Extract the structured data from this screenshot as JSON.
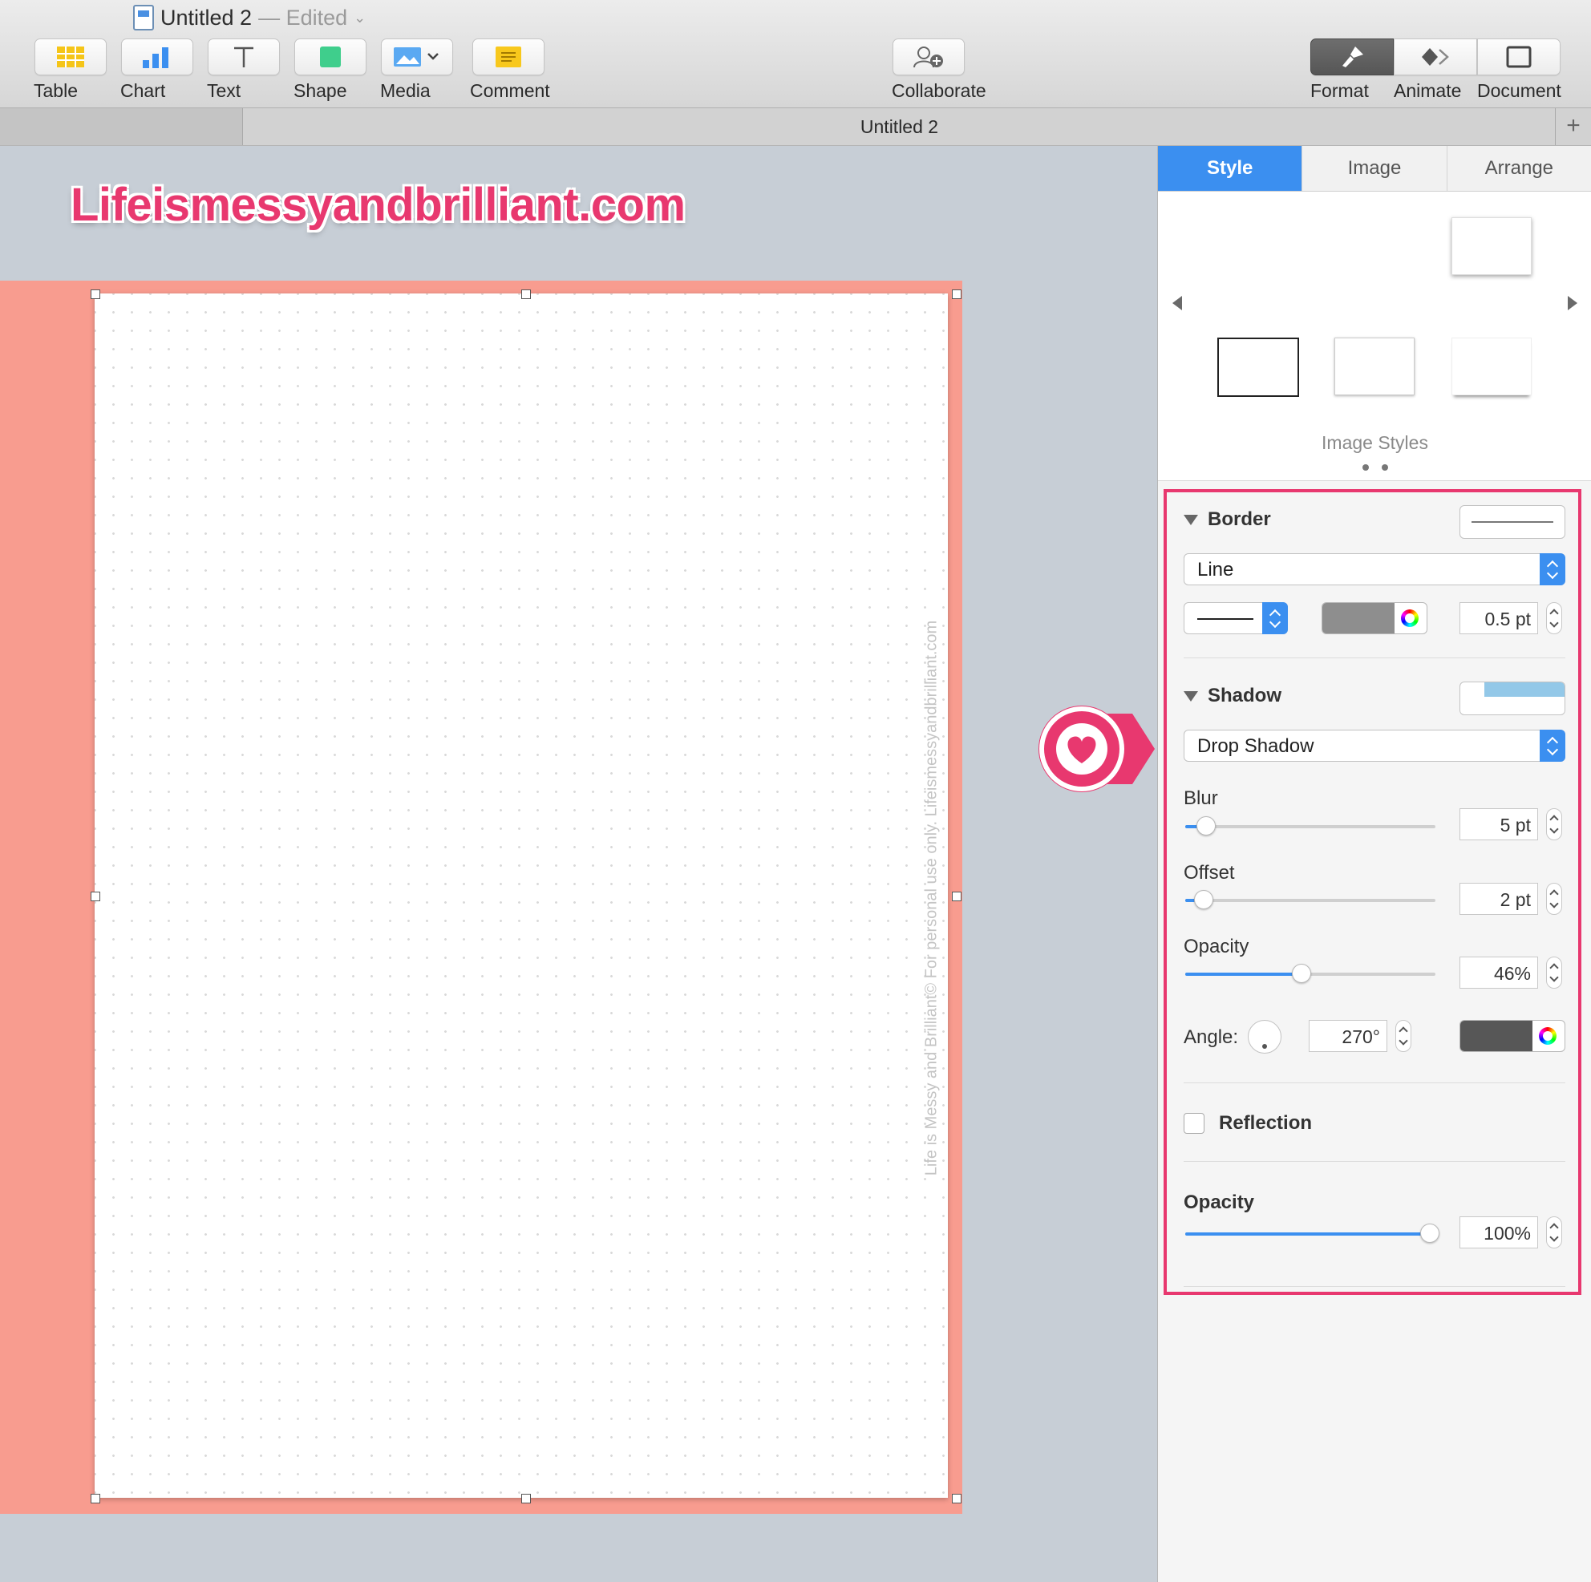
{
  "window": {
    "title": "Untitled 2",
    "status": "— Edited"
  },
  "toolbar": {
    "table": "Table",
    "chart": "Chart",
    "text": "Text",
    "shape": "Shape",
    "media": "Media",
    "comment": "Comment",
    "collaborate": "Collaborate",
    "format": "Format",
    "animate": "Animate",
    "document": "Document"
  },
  "tabbar": {
    "title": "Untitled 2",
    "add": "+"
  },
  "canvas": {
    "site": "Lifeismessyandbrilliant.com",
    "vertical_note": "Life is Messy and Brilliant© For personal use only. Lifeismessyandbrilliant.com"
  },
  "inspector": {
    "tabs": [
      "Style",
      "Image",
      "Arrange"
    ],
    "active_tab": "Style",
    "image_styles_label": "Image Styles",
    "border": {
      "title": "Border",
      "type": "Line",
      "width": "0.5 pt",
      "color": "#8e8e8e"
    },
    "shadow": {
      "title": "Shadow",
      "type": "Drop Shadow",
      "blur_label": "Blur",
      "blur_value": "5 pt",
      "blur_level": 0.08,
      "offset_label": "Offset",
      "offset_value": "2 pt",
      "offset_level": 0.07,
      "opacity_label": "Opacity",
      "opacity_value": "46%",
      "opacity_level": 0.46,
      "angle_label": "Angle:",
      "angle_value": "270°",
      "color": "#575757"
    },
    "reflection": {
      "label": "Reflection",
      "checked": false
    },
    "opacity": {
      "label": "Opacity",
      "value": "100%",
      "level": 1.0
    }
  },
  "colors": {
    "accent": "#3b8ff0",
    "brand_pink": "#e8386f",
    "slide_bg": "#f89c8f"
  }
}
